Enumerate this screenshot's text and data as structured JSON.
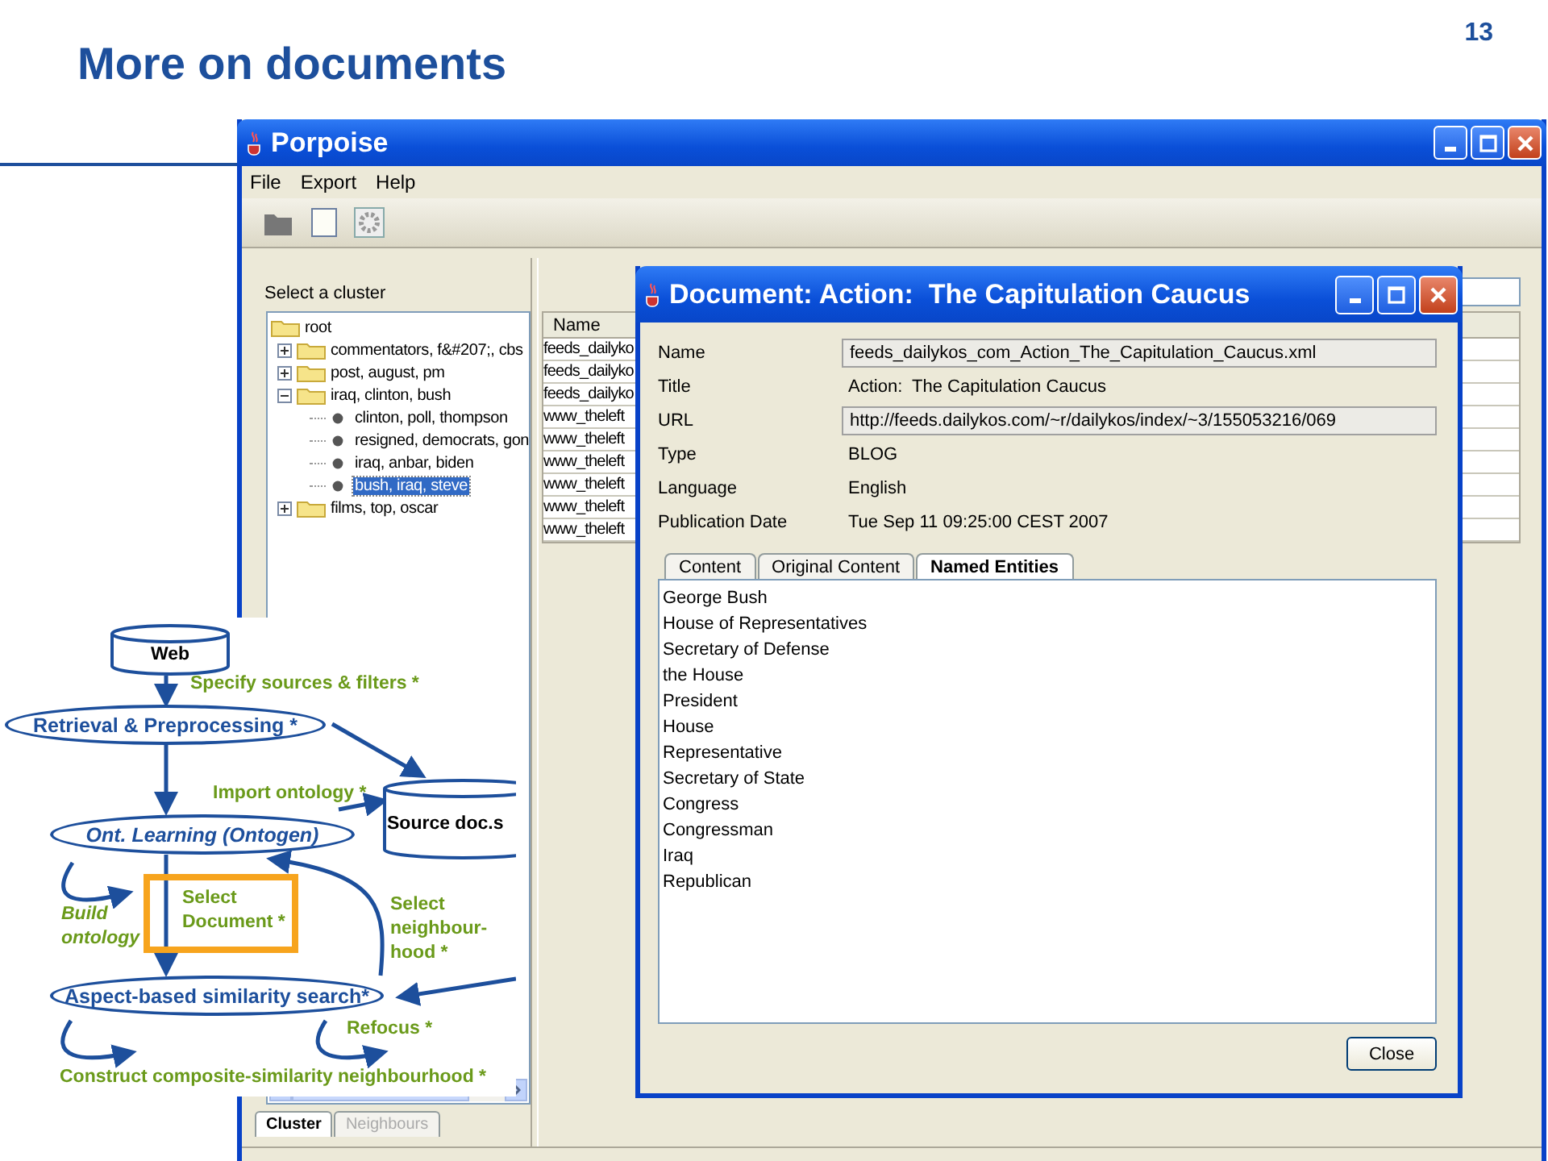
{
  "slide": {
    "title": "More on documents",
    "page_number": "13"
  },
  "app_window": {
    "title": "Porpoise",
    "menu": [
      "File",
      "Export",
      "Help"
    ]
  },
  "cluster_panel": {
    "label": "Select a cluster",
    "tree": [
      {
        "label": "root",
        "kind": "folder",
        "selected": false,
        "children": [
          {
            "label": "commentators, f&#207;, cbs",
            "kind": "folder",
            "expanded": false,
            "selected": false
          },
          {
            "label": "post, august, pm",
            "kind": "folder",
            "expanded": false,
            "selected": false
          },
          {
            "label": "iraq, clinton, bush",
            "kind": "folder",
            "expanded": true,
            "selected": false,
            "children": [
              {
                "label": "clinton, poll, thompson",
                "kind": "leaf",
                "selected": false
              },
              {
                "label": "resigned, democrats, gon",
                "kind": "leaf",
                "selected": false
              },
              {
                "label": "iraq, anbar, biden",
                "kind": "leaf",
                "selected": false
              },
              {
                "label": "bush, iraq, steve",
                "kind": "leaf",
                "selected": true
              }
            ]
          },
          {
            "label": "films, top, oscar",
            "kind": "folder",
            "expanded": false,
            "selected": false
          }
        ]
      }
    ],
    "tabs": [
      {
        "label": "Cluster",
        "selected": true,
        "disabled": false
      },
      {
        "label": "Neighbours",
        "selected": false,
        "disabled": true
      }
    ]
  },
  "documents_table": {
    "columns": [
      "Name"
    ],
    "rows": [
      [
        "feeds_dailyko"
      ],
      [
        "feeds_dailyko"
      ],
      [
        "feeds_dailyko"
      ],
      [
        "www_theleft"
      ],
      [
        "www_theleft"
      ],
      [
        "www_theleft"
      ],
      [
        "www_theleft"
      ],
      [
        "www_theleft"
      ],
      [
        "www_theleft"
      ]
    ]
  },
  "document_dialog": {
    "title": "Document: Action:  The Capitulation Caucus",
    "fields": [
      {
        "label": "Name",
        "value": "feeds_dailykos_com_Action_The_Capitulation_Caucus.xml",
        "kind": "field"
      },
      {
        "label": "Title",
        "value": "Action:  The Capitulation Caucus",
        "kind": "text"
      },
      {
        "label": "URL",
        "value": "http://feeds.dailykos.com/~r/dailykos/index/~3/155053216/069",
        "kind": "field"
      },
      {
        "label": "Type",
        "value": "BLOG",
        "kind": "text"
      },
      {
        "label": "Language",
        "value": "English",
        "kind": "text"
      },
      {
        "label": "Publication Date",
        "value": "Tue Sep 11 09:25:00 CEST 2007",
        "kind": "text"
      }
    ],
    "tabs": [
      {
        "label": "Content",
        "selected": false
      },
      {
        "label": "Original Content",
        "selected": false
      },
      {
        "label": "Named Entities",
        "selected": true
      }
    ],
    "named_entities": [
      "George Bush",
      "House of Representatives",
      "Secretary of Defense",
      "the House",
      "President",
      "House",
      "Representative",
      "Secretary of State",
      "Congress",
      "Congressman",
      "Iraq",
      "Republican"
    ],
    "close_button": "Close"
  },
  "diagram": {
    "nodes": [
      {
        "kind": "store",
        "label": "Web"
      },
      {
        "kind": "process",
        "label": "Retrieval & Preprocessing *"
      },
      {
        "kind": "store",
        "label": "Source doc.s"
      },
      {
        "kind": "process",
        "label": "Ont. Learning (Ontogen)"
      },
      {
        "kind": "process",
        "label": "Aspect-based similarity search*"
      }
    ],
    "annotations": [
      {
        "label": "Specify sources & filters *",
        "highlighted": false
      },
      {
        "label": "Import ontology *",
        "highlighted": false
      },
      {
        "label": "Build ontology",
        "highlighted": false
      },
      {
        "label": "Select Document *",
        "highlighted": true
      },
      {
        "label": "Select neighbour-hood *",
        "highlighted": false
      },
      {
        "label": "Refocus *",
        "highlighted": false
      },
      {
        "label": "Construct composite-similarity neighbourhood *",
        "highlighted": false
      }
    ]
  }
}
